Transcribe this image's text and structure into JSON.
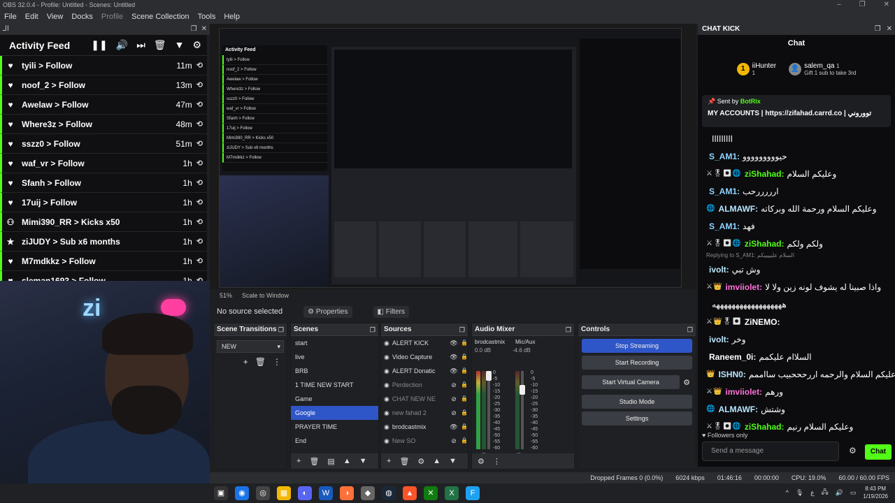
{
  "window": {
    "title": "OBS 32.0.4 - Profile: Untitled - Scenes: Untitled",
    "controls": [
      "–",
      "❐",
      "✕"
    ]
  },
  "menu": [
    {
      "label": "File",
      "dim": false
    },
    {
      "label": "Edit",
      "dim": false
    },
    {
      "label": "View",
      "dim": false
    },
    {
      "label": "Docks",
      "dim": false
    },
    {
      "label": "Profile",
      "dim": true
    },
    {
      "label": "Scene Collection",
      "dim": false
    },
    {
      "label": "Tools",
      "dim": false
    },
    {
      "label": "Help",
      "dim": false
    }
  ],
  "activity_dock": {
    "tab_label": "الـ",
    "controls": [
      "❐",
      "✕"
    ]
  },
  "activity": {
    "title": "Activity Feed",
    "header_icons": [
      "pause-icon",
      "volume-icon",
      "skip-icon",
      "trash-icon",
      "filter-icon",
      "gear-icon"
    ],
    "rows": [
      {
        "icon": "heart-icon",
        "text": "tyili > Follow",
        "time": "11m"
      },
      {
        "icon": "heart-icon",
        "text": "noof_2 > Follow",
        "time": "13m"
      },
      {
        "icon": "heart-icon",
        "text": "Awelaw > Follow",
        "time": "47m"
      },
      {
        "icon": "heart-icon",
        "text": "Where3z > Follow",
        "time": "48m"
      },
      {
        "icon": "heart-icon",
        "text": "sszz0 > Follow",
        "time": "51m"
      },
      {
        "icon": "heart-icon",
        "text": "waf_vr > Follow",
        "time": "1h"
      },
      {
        "icon": "heart-icon",
        "text": "Sfanh > Follow",
        "time": "1h"
      },
      {
        "icon": "heart-icon",
        "text": "17uij > Follow",
        "time": "1h"
      },
      {
        "icon": "kick-icon",
        "text": "Mimi390_RR > Kicks x50",
        "time": "1h"
      },
      {
        "icon": "star-icon",
        "text": "ziJUDY > Sub x6 months",
        "time": "1h"
      },
      {
        "icon": "heart-icon",
        "text": "M7mdkkz > Follow",
        "time": "1h"
      },
      {
        "icon": "heart-icon",
        "text": "sleman1693 > Follow",
        "time": "1h"
      }
    ]
  },
  "preview": {
    "zoom": "51%",
    "scale_mode": "Scale to Window",
    "no_source": "No source selected",
    "properties": "Properties",
    "filters": "Filters",
    "mini_feed": [
      "tyili > Follow",
      "noof_2 > Follow",
      "Awelaw > Follow",
      "Where3z > Follow",
      "sszz0 > Follow",
      "waf_vr > Follow",
      "Sfanh > Follow",
      "17uij > Follow",
      "Mimi390_RR > Kicks x50",
      "ziJUDY > Sub x6 months",
      "M7mdkkz > Follow"
    ],
    "mini_feed_title": "Activity Feed"
  },
  "transitions": {
    "title": "Scene Transitions",
    "selected": "NEW"
  },
  "scenes": {
    "title": "Scenes",
    "items": [
      "start",
      "live",
      "BRB",
      "1 TIME NEW START",
      "Game",
      "Google",
      "PRAYER TIME",
      "End"
    ],
    "active_index": 5
  },
  "sources": {
    "title": "Sources",
    "items": [
      {
        "name": "ALERT KICK",
        "visible": true
      },
      {
        "name": "Video Capture",
        "visible": true
      },
      {
        "name": "ALERT Donatic",
        "visible": true
      },
      {
        "name": "Perdection",
        "visible": false
      },
      {
        "name": "CHAT NEW NE",
        "visible": false
      },
      {
        "name": "new fahad 2",
        "visible": false
      },
      {
        "name": "brodcastmix",
        "visible": true
      },
      {
        "name": "New SO",
        "visible": false
      }
    ]
  },
  "mixer": {
    "title": "Audio Mixer",
    "channels": [
      {
        "name": "brodcastmix",
        "db": "0.0 dB"
      },
      {
        "name": "Mic/Aux",
        "db": "-4.6 dB"
      }
    ],
    "scale": [
      "0",
      "-5",
      "-10",
      "-15",
      "-20",
      "-25",
      "-30",
      "-35",
      "-40",
      "-45",
      "-50",
      "-55",
      "-60"
    ]
  },
  "controls": {
    "title": "Controls",
    "buttons": [
      "Stop Streaming",
      "Start Recording",
      "Start Virtual Camera",
      "Studio Mode",
      "Settings"
    ]
  },
  "chat": {
    "dock_label": "CHAT KICK",
    "title": "Chat",
    "gifters": [
      {
        "rank": "1",
        "name": "iiHunter",
        "count": "1"
      },
      {
        "rank": "",
        "name": "salem_qa",
        "count": "1",
        "sub": "Gift 1 sub to take 3rd"
      }
    ],
    "pinned": {
      "sent_by": "Sent by",
      "bot": "BotRix",
      "text": "MY ACCOUNTS | https://zifahad.carrd.co | تووروني"
    },
    "messages": [
      {
        "badges": "",
        "user": "",
        "color": "#8fd3ff",
        "text": "ااااااااا"
      },
      {
        "badges": "",
        "user": "S_AM1:",
        "color": "#8fd3ff",
        "text": "حيووووووووو"
      },
      {
        "badges": "⚔🎖⏺🌐",
        "user": "ziShahad:",
        "color": "#53fc18",
        "text": "وعليكم السلام"
      },
      {
        "badges": "",
        "user": "S_AM1:",
        "color": "#8fd3ff",
        "text": "ارررررحب"
      },
      {
        "badges": "🌐",
        "user": "ALMAWF:",
        "color": "#b8e7ff",
        "text": "وعليكم السلام ورحمة الله وبركاته"
      },
      {
        "badges": "",
        "user": "S_AM1:",
        "color": "#8fd3ff",
        "text": "فهد"
      },
      {
        "badges": "⚔🎖⏺🌐",
        "user": "ziShahad:",
        "color": "#53fc18",
        "text": "ولكم ولكم"
      },
      {
        "badges": "",
        "user": "ivolt:",
        "color": "#b8e7ff",
        "text": "وش تبي",
        "reply": "Replying to S_AM1: السلام عليييييكم"
      },
      {
        "badges": "⚔👑",
        "user": "imviiolet:",
        "color": "#ff6fd8",
        "text": "واذا صبينا له يشوف لونه زين ولا لا"
      },
      {
        "badges": "",
        "user": "",
        "color": "#fff",
        "text": "ههههههههههههههههههه"
      },
      {
        "badges": "⚔👑🎖⏺",
        "user": "ZiNEMO:",
        "color": "#ffffff",
        "text": ""
      },
      {
        "badges": "",
        "user": "ivolt:",
        "color": "#b8e7ff",
        "text": "وخر"
      },
      {
        "badges": "",
        "user": "Raneem_0i:",
        "color": "#ffffff",
        "text": "السلاام عليكمم"
      },
      {
        "badges": "👑",
        "user": "ISHN0:",
        "color": "#b8e7ff",
        "text": "وعليكم السلام والرحمه اررحححبيب سااممم"
      },
      {
        "badges": "⚔👑",
        "user": "imviiolet:",
        "color": "#ff6fd8",
        "text": "ورهم"
      },
      {
        "badges": "🌐",
        "user": "ALMAWF:",
        "color": "#b8e7ff",
        "text": "وشتش"
      },
      {
        "badges": "⚔🎖⏺🌐",
        "user": "ziShahad:",
        "color": "#53fc18",
        "text": "وعليكم السلام رنيم"
      }
    ],
    "followers_only": "Followers only",
    "placeholder": "Send a message",
    "send_label": "Chat"
  },
  "status": {
    "dropped": "Dropped Frames 0 (0.0%)",
    "bitrate": "6024 kbps",
    "stream_time": "01:46:16",
    "rec_time": "00:00:00",
    "cpu": "CPU: 19.0%",
    "fps": "60.00 / 60.00 FPS"
  },
  "taskbar": {
    "time": "8:43 PM",
    "date": "1/19/2026",
    "lang": "ع"
  }
}
